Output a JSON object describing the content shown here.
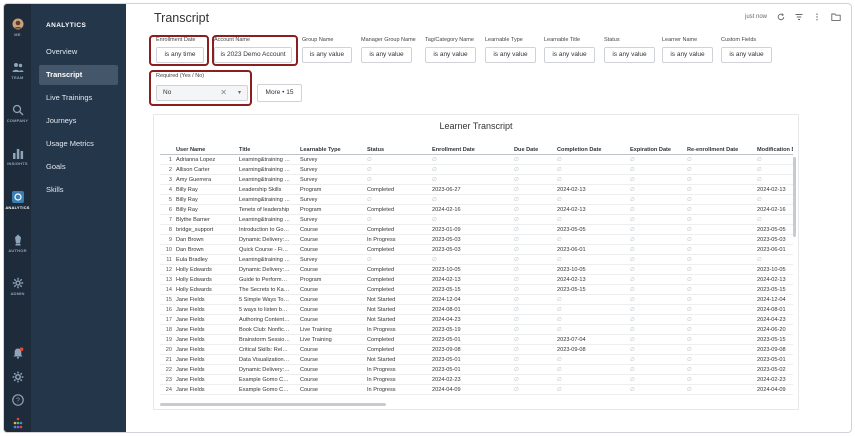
{
  "rail": [
    {
      "key": "me",
      "label": "ME"
    },
    {
      "key": "team",
      "label": "TEAM"
    },
    {
      "key": "company",
      "label": "COMPANY"
    },
    {
      "key": "insights",
      "label": "INSIGHTS"
    },
    {
      "key": "analytics",
      "label": "ANALYTICS"
    },
    {
      "key": "author",
      "label": "AUTHOR"
    },
    {
      "key": "admin",
      "label": "ADMIN"
    }
  ],
  "nav": {
    "title": "ANALYTICS",
    "items": [
      "Overview",
      "Transcript",
      "Live Trainings",
      "Journeys",
      "Usage Metrics",
      "Goals",
      "Skills"
    ]
  },
  "page": {
    "title": "Transcript"
  },
  "topbar": {
    "status": "just now"
  },
  "filters": [
    {
      "label": "Enrollment Date",
      "value": "is any time"
    },
    {
      "label": "Account Name",
      "value": "is 2023 Demo Account"
    },
    {
      "label": "Group Name",
      "value": "is any value"
    },
    {
      "label": "Manager Group Name",
      "value": "is any value"
    },
    {
      "label": "Tag/Category Name",
      "value": "is any value"
    },
    {
      "label": "Learnable Type",
      "value": "is any value"
    },
    {
      "label": "Learnable Title",
      "value": "is any value"
    },
    {
      "label": "Status",
      "value": "is any value"
    },
    {
      "label": "Learner Name",
      "value": "is any value"
    },
    {
      "label": "Custom Fields",
      "value": "is any value"
    }
  ],
  "required": {
    "label": "Required (Yes / No)",
    "value": "No",
    "clear": "✕",
    "dropdown": "▾"
  },
  "more": {
    "label": "More • 15"
  },
  "table": {
    "title": "Learner Transcript",
    "columns": [
      "",
      "User Name",
      "Title",
      "Learnable Type",
      "Status",
      "Enrollment Date",
      "Due Date",
      "Completion Date",
      "Expiration Date",
      "Re-enrollment Date",
      "Modification Da"
    ],
    "empty": "∅",
    "rows": [
      [
        "1",
        "Adrianna Lopez",
        "Learning&training …",
        "Survey",
        "∅",
        "∅",
        "∅",
        "∅",
        "∅",
        "∅",
        "∅"
      ],
      [
        "2",
        "Allison Carter",
        "Learning&training …",
        "Survey",
        "∅",
        "∅",
        "∅",
        "∅",
        "∅",
        "∅",
        "∅"
      ],
      [
        "3",
        "Amy Guerrera",
        "Learning&training …",
        "Survey",
        "∅",
        "∅",
        "∅",
        "∅",
        "∅",
        "∅",
        "∅"
      ],
      [
        "4",
        "Billy Ray",
        "Leadership Skills",
        "Program",
        "Completed",
        "2023-06-27",
        "∅",
        "2024-02-13",
        "∅",
        "∅",
        "2024-02-13"
      ],
      [
        "5",
        "Billy Ray",
        "Learning&training …",
        "Survey",
        "∅",
        "∅",
        "∅",
        "∅",
        "∅",
        "∅",
        "∅"
      ],
      [
        "6",
        "Billy Ray",
        "Tenets of leadership",
        "Program",
        "Completed",
        "2024-02-16",
        "∅",
        "2024-02-13",
        "∅",
        "∅",
        "2024-02-16"
      ],
      [
        "7",
        "Blythe Barner",
        "Learning&training …",
        "Survey",
        "∅",
        "∅",
        "∅",
        "∅",
        "∅",
        "∅",
        "∅"
      ],
      [
        "8",
        "bridge_support",
        "Introduction to Go…",
        "Course",
        "Completed",
        "2023-01-09",
        "∅",
        "2023-05-05",
        "∅",
        "∅",
        "2023-05-05"
      ],
      [
        "9",
        "Dan Brown",
        "Dynamic Delivery:…",
        "Course",
        "In Progress",
        "2023-05-03",
        "∅",
        "∅",
        "∅",
        "∅",
        "2023-05-03"
      ],
      [
        "10",
        "Dan Brown",
        "Quick Course - Fi…",
        "Course",
        "Completed",
        "2023-05-03",
        "∅",
        "2023-06-01",
        "∅",
        "∅",
        "2023-06-01"
      ],
      [
        "11",
        "Eula Bradley",
        "Learning&training …",
        "Survey",
        "∅",
        "∅",
        "∅",
        "∅",
        "∅",
        "∅",
        "∅"
      ],
      [
        "12",
        "Holly Edwards",
        "Dynamic Delivery:…",
        "Course",
        "Completed",
        "2023-10-05",
        "∅",
        "2023-10-05",
        "∅",
        "∅",
        "2023-10-05"
      ],
      [
        "13",
        "Holly Edwards",
        "Guide to Perform…",
        "Program",
        "Completed",
        "2024-02-13",
        "∅",
        "2024-02-13",
        "∅",
        "∅",
        "2024-02-13"
      ],
      [
        "14",
        "Holly Edwards",
        "The Secrets to Ka…",
        "Course",
        "Completed",
        "2023-05-15",
        "∅",
        "2023-05-15",
        "∅",
        "∅",
        "2023-05-15"
      ],
      [
        "15",
        "Jane Fields",
        "5 Simple Ways To…",
        "Course",
        "Not Started",
        "2024-12-04",
        "∅",
        "∅",
        "∅",
        "∅",
        "2024-12-04"
      ],
      [
        "16",
        "Jane Fields",
        "5 ways to listen b…",
        "Course",
        "Not Started",
        "2024-08-01",
        "∅",
        "∅",
        "∅",
        "∅",
        "2024-08-01"
      ],
      [
        "17",
        "Jane Fields",
        "Authoring Content…",
        "Course",
        "Not Started",
        "2024-04-23",
        "∅",
        "∅",
        "∅",
        "∅",
        "2024-04-23"
      ],
      [
        "18",
        "Jane Fields",
        "Book Club: Nonfic…",
        "Live Training",
        "In Progress",
        "2023-05-19",
        "∅",
        "∅",
        "∅",
        "∅",
        "2024-06-20"
      ],
      [
        "19",
        "Jane Fields",
        "Brainstorm Sessio…",
        "Live Training",
        "Completed",
        "2023-05-01",
        "∅",
        "2023-07-04",
        "∅",
        "∅",
        "2023-05-15"
      ],
      [
        "20",
        "Jane Fields",
        "Critical Skills: Rel…",
        "Course",
        "Completed",
        "2023-09-08",
        "∅",
        "2023-09-08",
        "∅",
        "∅",
        "2023-09-08"
      ],
      [
        "21",
        "Jane Fields",
        "Data Visualization…",
        "Course",
        "Not Started",
        "2023-05-01",
        "∅",
        "∅",
        "∅",
        "∅",
        "2023-05-01"
      ],
      [
        "22",
        "Jane Fields",
        "Dynamic Delivery:…",
        "Course",
        "In Progress",
        "2023-05-01",
        "∅",
        "∅",
        "∅",
        "∅",
        "2023-05-02"
      ],
      [
        "23",
        "Jane Fields",
        "Example Gomo C…",
        "Course",
        "In Progress",
        "2024-02-23",
        "∅",
        "∅",
        "∅",
        "∅",
        "2024-02-23"
      ],
      [
        "24",
        "Jane Fields",
        "Example Gomo C…",
        "Course",
        "In Progress",
        "2024-04-09",
        "∅",
        "∅",
        "∅",
        "∅",
        "2024-04-09"
      ]
    ]
  }
}
